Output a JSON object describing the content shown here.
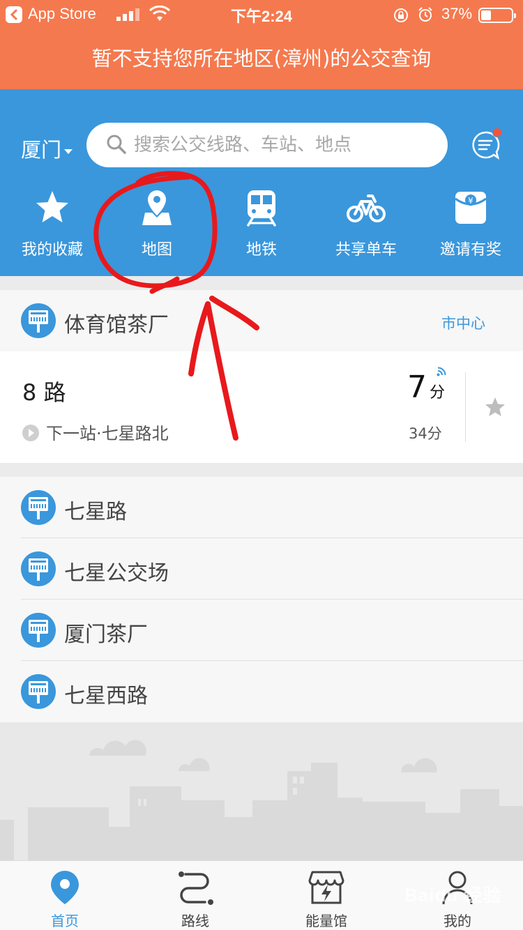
{
  "status_bar": {
    "back_app": "App Store",
    "time": "下午2:24",
    "battery": "37%"
  },
  "notice": "暂不支持您所在地区(漳州)的公交查询",
  "header": {
    "city": "厦门",
    "search_placeholder": "搜索公交线路、车站、地点",
    "quick": [
      {
        "label": "我的收藏",
        "icon": "star-icon"
      },
      {
        "label": "地图",
        "icon": "map-pin-icon"
      },
      {
        "label": "地铁",
        "icon": "subway-icon"
      },
      {
        "label": "共享单车",
        "icon": "bicycle-icon"
      },
      {
        "label": "邀请有奖",
        "icon": "red-envelope-icon"
      }
    ]
  },
  "nearby": {
    "stop_name": "体育馆茶厂",
    "direction": "市中心",
    "route": {
      "number": "8 路",
      "next_stop": "下一站·七星路北",
      "eta_value": "7",
      "eta_unit": "分",
      "eta_next": "34分"
    }
  },
  "stops": [
    {
      "name": "七星路"
    },
    {
      "name": "七星公交场"
    },
    {
      "name": "厦门茶厂"
    },
    {
      "name": "七星西路"
    }
  ],
  "tabs": [
    {
      "label": "首页",
      "icon": "home-pin-icon",
      "active": true
    },
    {
      "label": "路线",
      "icon": "route-icon",
      "active": false
    },
    {
      "label": "能量馆",
      "icon": "energy-store-icon",
      "active": false
    },
    {
      "label": "我的",
      "icon": "profile-icon",
      "active": false
    }
  ],
  "watermark": "Baidu 经验",
  "colors": {
    "notice_bg": "#f5794e",
    "header_bg": "#3a97dc",
    "accent": "#3a97dc",
    "badge": "#f5533d",
    "annotation": "#e8191c"
  }
}
